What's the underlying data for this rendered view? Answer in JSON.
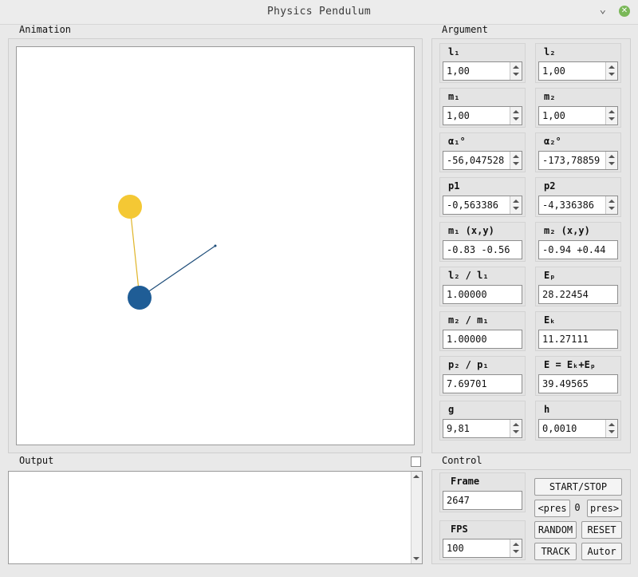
{
  "window": {
    "title": "Physics Pendulum"
  },
  "sections": {
    "animation": "Animation",
    "argument": "Argument",
    "output": "Output",
    "control": "Control"
  },
  "colors": {
    "bob1": "#f4c834",
    "bob2": "#1f5d96",
    "rod1": "#e0b52a",
    "rod2": "#1f4e7a"
  },
  "args": [
    {
      "label": "l₁",
      "value": "1,00",
      "spin": true
    },
    {
      "label": "l₂",
      "value": "1,00",
      "spin": true
    },
    {
      "label": "m₁",
      "value": "1,00",
      "spin": true
    },
    {
      "label": "m₂",
      "value": "1,00",
      "spin": true
    },
    {
      "label": "α₁°",
      "value": "-56,047528",
      "spin": true
    },
    {
      "label": "α₂°",
      "value": "-173,78859",
      "spin": true
    },
    {
      "label": "p1",
      "value": "-0,563386",
      "spin": true
    },
    {
      "label": "p2",
      "value": "-4,336386",
      "spin": true
    },
    {
      "label": "m₁ (x,y)",
      "value": "-0.83 -0.56",
      "spin": false
    },
    {
      "label": "m₂ (x,y)",
      "value": "-0.94 +0.44",
      "spin": false
    },
    {
      "label": "l₂ / l₁",
      "value": "1.00000",
      "spin": false
    },
    {
      "label": "Eₚ",
      "value": "28.22454",
      "spin": false
    },
    {
      "label": "m₂ / m₁",
      "value": "1.00000",
      "spin": false
    },
    {
      "label": "Eₖ",
      "value": "11.27111",
      "spin": false
    },
    {
      "label": "p₂ / p₁",
      "value": "7.69701",
      "spin": false
    },
    {
      "label": "E = Eₖ+Eₚ",
      "value": "39.49565",
      "spin": false
    },
    {
      "label": "g",
      "value": "9,81",
      "spin": true
    },
    {
      "label": "h",
      "value": "0,0010",
      "spin": true
    }
  ],
  "control": {
    "frame_label": "Frame",
    "frame_value": "2647",
    "fps_label": "FPS",
    "fps_value": "100",
    "start_stop": "START/STOP",
    "pres_prev": "<pres",
    "pres_value": "0",
    "pres_next": "pres>",
    "random": "RANDOM",
    "reset": "RESET",
    "track": "TRACK",
    "autor": "Autor"
  },
  "output": {
    "text": ""
  }
}
